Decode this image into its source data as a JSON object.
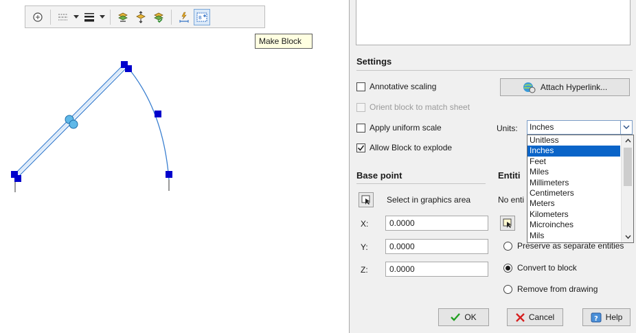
{
  "toolbar": {
    "tooltip": "Make Block",
    "icons": [
      "zoom-icon",
      "linetype-icon",
      "lineweight-icon",
      "layer-icon",
      "layer-move-icon",
      "layer-check-icon",
      "insert-block-icon",
      "make-block-icon"
    ]
  },
  "settings": {
    "title": "Settings",
    "annotative_scaling": "Annotative scaling",
    "annotative_checked": false,
    "attach_hyperlink": "Attach Hyperlink...",
    "orient_block": "Orient block to match sheet",
    "orient_enabled": false,
    "apply_uniform_scale": "Apply uniform scale",
    "uniform_checked": false,
    "allow_explode": "Allow Block to explode",
    "explode_checked": true,
    "units_label": "Units:",
    "units_value": "Inches",
    "units_options": [
      "Unitless",
      "Inches",
      "Feet",
      "Miles",
      "Millimeters",
      "Centimeters",
      "Meters",
      "Kilometers",
      "Microinches",
      "Mils"
    ],
    "units_selected": "Inches"
  },
  "base_point": {
    "title": "Base point",
    "select_label": "Select in graphics area",
    "x_label": "X:",
    "x_value": "0.0000",
    "y_label": "Y:",
    "y_value": "0.0000",
    "z_label": "Z:",
    "z_value": "0.0000"
  },
  "entities": {
    "title": "Entiti",
    "status": "No enti",
    "preserve": "Preserve as separate entities",
    "convert": "Convert to block",
    "remove": "Remove from drawing",
    "selected": "convert"
  },
  "buttons": {
    "ok": "OK",
    "cancel": "Cancel",
    "help": "Help"
  },
  "colors": {
    "grip": "#0000cc",
    "selection_highlight": "#0a64c8",
    "arc": "#3a7fd0"
  }
}
